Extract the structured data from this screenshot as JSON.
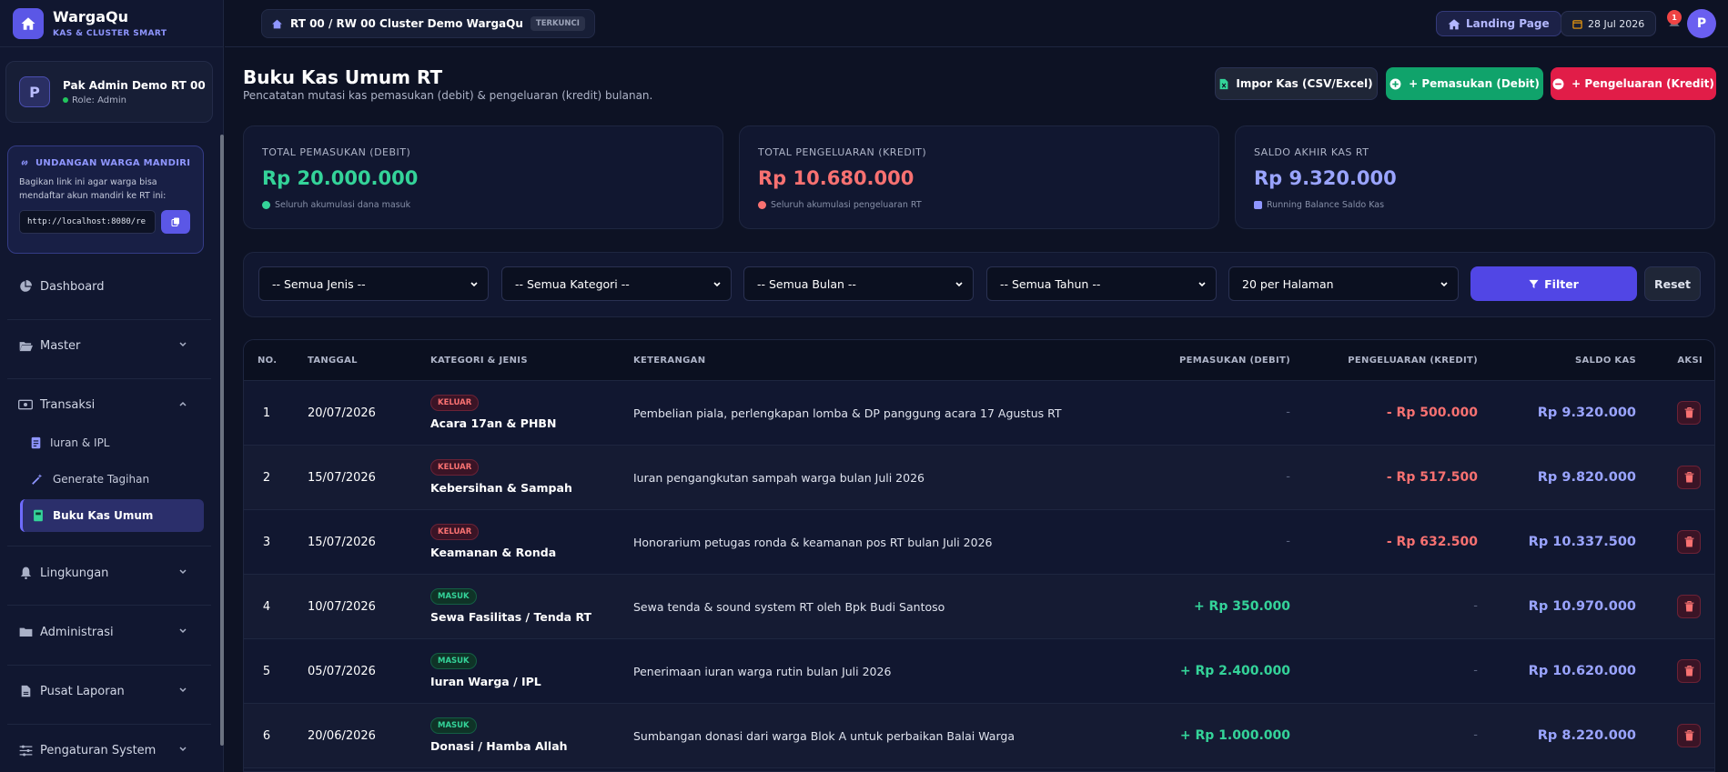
{
  "brand": {
    "name": "WargaQu",
    "subtitle": "KAS & CLUSTER SMART"
  },
  "user": {
    "initial": "P",
    "name": "Pak Admin Demo RT 00",
    "role": "Role: Admin"
  },
  "invite": {
    "title": "UNDANGAN WARGA MANDIRI",
    "text": "Bagikan link ini agar warga bisa mendaftar akun mandiri ke RT ini:",
    "link": "http://localhost:8080/re"
  },
  "nav": {
    "dashboard": "Dashboard",
    "master": "Master",
    "transaksi": "Transaksi",
    "iuran": "Iuran & IPL",
    "generate": "Generate Tagihan",
    "buku_kas": "Buku Kas Umum",
    "lingkungan": "Lingkungan",
    "administrasi": "Administrasi",
    "laporan": "Pusat Laporan",
    "pengaturan": "Pengaturan System"
  },
  "topbar": {
    "breadcrumb": "RT 00 / RW 00 Cluster Demo WargaQu",
    "lock_badge": "TERKUNCI",
    "landing": "Landing Page",
    "date": "28 Jul 2026",
    "notif_count": "1",
    "avatar": "P"
  },
  "page": {
    "title": "Buku Kas Umum RT",
    "subtitle": "Pencatatan mutasi kas pemasukan (debit) & pengeluaran (kredit) bulanan.",
    "btn_import": "Impor Kas (CSV/Excel)",
    "btn_in": "+ Pemasukan (Debit)",
    "btn_out": "+ Pengeluaran (Kredit)"
  },
  "stats": [
    {
      "label": "TOTAL PEMASUKAN (DEBIT)",
      "value": "Rp 20.000.000",
      "note": "Seluruh akumulasi dana masuk",
      "color": "#34d399"
    },
    {
      "label": "TOTAL PENGELUARAN (KREDIT)",
      "value": "Rp 10.680.000",
      "note": "Seluruh akumulasi pengeluaran RT",
      "color": "#f87171"
    },
    {
      "label": "SALDO AKHIR KAS RT",
      "value": "Rp 9.320.000",
      "note": "Running Balance Saldo Kas",
      "color": "#9aa4ff"
    }
  ],
  "filters": {
    "jenis": "-- Semua Jenis --",
    "kategori": "-- Semua Kategori --",
    "bulan": "-- Semua Bulan --",
    "tahun": "-- Semua Tahun --",
    "per_page": "20 per Halaman",
    "filter_btn": "Filter",
    "reset_btn": "Reset"
  },
  "table": {
    "headers": [
      "NO.",
      "TANGGAL",
      "KATEGORI & JENIS",
      "KETERANGAN",
      "PEMASUKAN (DEBIT)",
      "PENGELUARAN (KREDIT)",
      "SALDO KAS",
      "AKSI"
    ],
    "rows": [
      {
        "no": "1",
        "date": "20/07/2026",
        "type": "KELUAR",
        "category": "Acara 17an & PHBN",
        "desc": "Pembelian piala, perlengkapan lomba & DP panggung acara 17 Agustus RT",
        "debit": "-",
        "credit": "- Rp 500.000",
        "balance": "Rp 9.320.000"
      },
      {
        "no": "2",
        "date": "15/07/2026",
        "type": "KELUAR",
        "category": "Kebersihan & Sampah",
        "desc": "Iuran pengangkutan sampah warga bulan Juli 2026",
        "debit": "-",
        "credit": "- Rp 517.500",
        "balance": "Rp 9.820.000"
      },
      {
        "no": "3",
        "date": "15/07/2026",
        "type": "KELUAR",
        "category": "Keamanan & Ronda",
        "desc": "Honorarium petugas ronda & keamanan pos RT bulan Juli 2026",
        "debit": "-",
        "credit": "- Rp 632.500",
        "balance": "Rp 10.337.500"
      },
      {
        "no": "4",
        "date": "10/07/2026",
        "type": "MASUK",
        "category": "Sewa Fasilitas / Tenda RT",
        "desc": "Sewa tenda & sound system RT oleh Bpk Budi Santoso",
        "debit": "+ Rp 350.000",
        "credit": "-",
        "balance": "Rp 10.970.000"
      },
      {
        "no": "5",
        "date": "05/07/2026",
        "type": "MASUK",
        "category": "Iuran Warga / IPL",
        "desc": "Penerimaan iuran warga rutin bulan Juli 2026",
        "debit": "+ Rp 2.400.000",
        "credit": "-",
        "balance": "Rp 10.620.000"
      },
      {
        "no": "6",
        "date": "20/06/2026",
        "type": "MASUK",
        "category": "Donasi / Hamba Allah",
        "desc": "Sumbangan donasi dari warga Blok A untuk perbaikan Balai Warga",
        "debit": "+ Rp 1.000.000",
        "credit": "-",
        "balance": "Rp 8.220.000"
      }
    ]
  }
}
